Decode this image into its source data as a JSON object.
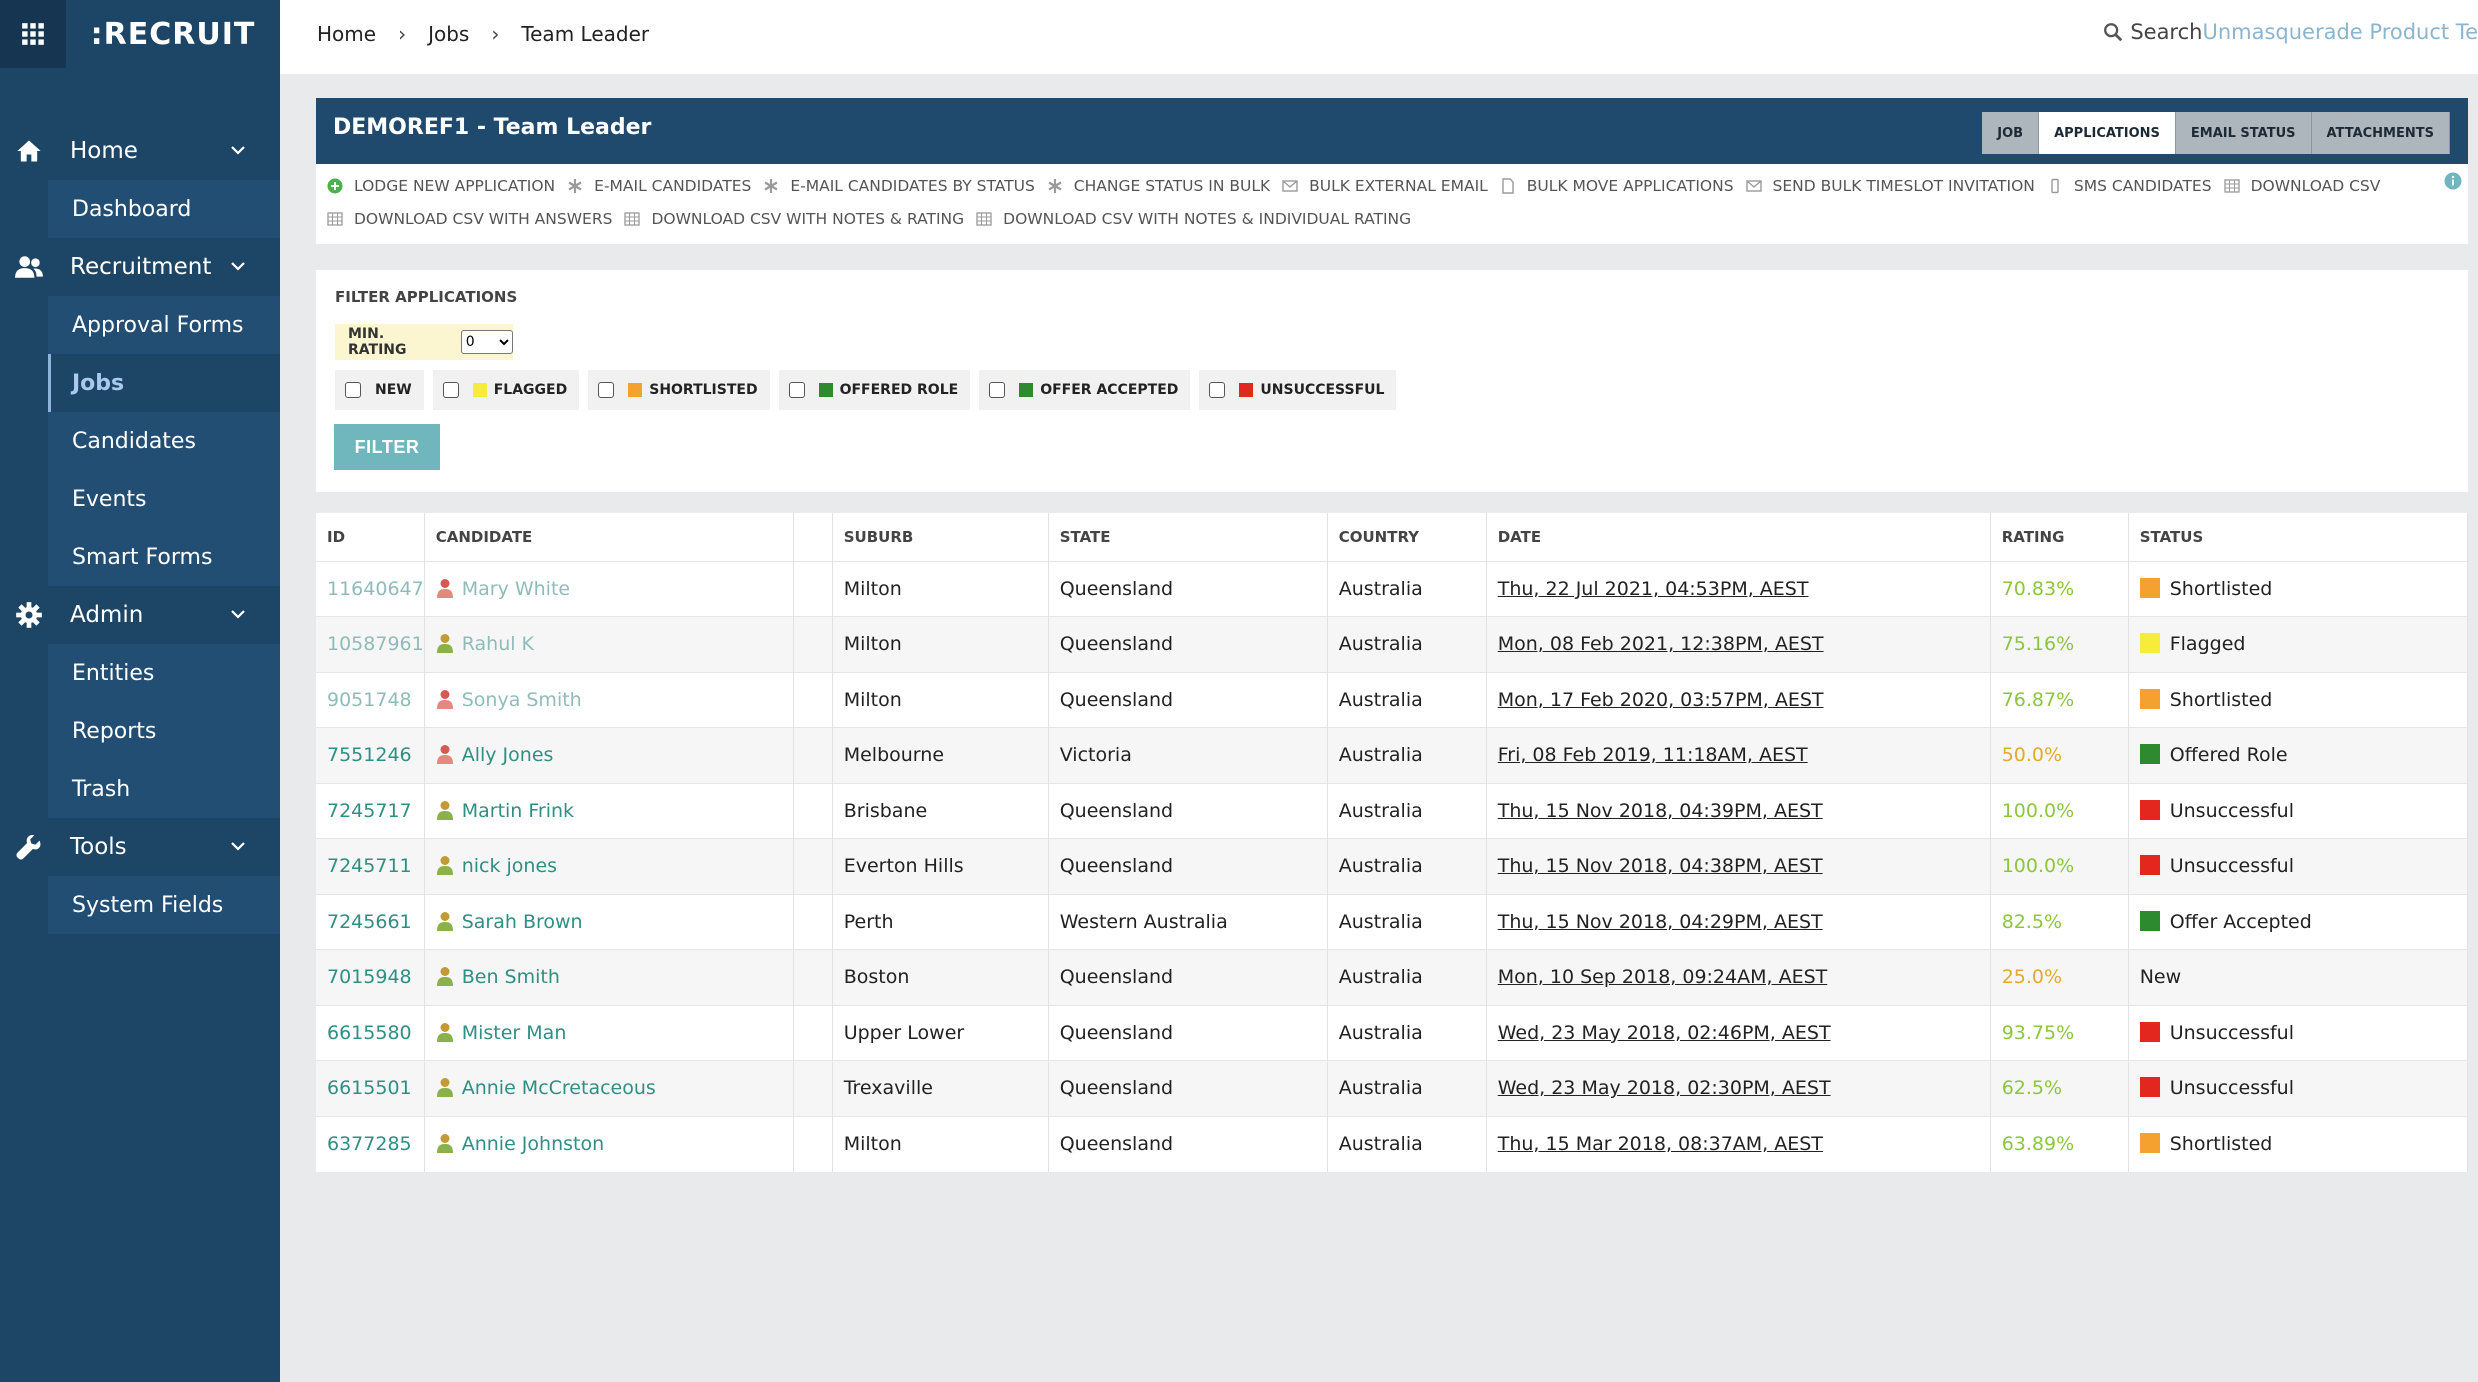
{
  "app": {
    "logo": ":RECRUIT"
  },
  "colors": {
    "sidebar": "#1d4565",
    "header": "#1f4a6e",
    "accent": "#6fb7bd",
    "link": "#2f8f83",
    "rating_green": "#8cc63f",
    "rating_amber": "#e6a82e",
    "status": {
      "Shortlisted": "#f5a130",
      "Flagged": "#f7ec3a",
      "Offered Role": "#2e8a2e",
      "Offer Accepted": "#2e8a2e",
      "Unsuccessful": "#e3261e",
      "New": "transparent"
    }
  },
  "sidebar": {
    "home": {
      "label": "Home",
      "icon": "home-icon",
      "items": [
        {
          "label": "Dashboard"
        }
      ]
    },
    "recruitment": {
      "label": "Recruitment",
      "icon": "users-icon",
      "items": [
        {
          "label": "Approval Forms"
        },
        {
          "label": "Jobs"
        },
        {
          "label": "Candidates"
        },
        {
          "label": "Events"
        },
        {
          "label": "Smart Forms"
        }
      ]
    },
    "admin": {
      "label": "Admin",
      "icon": "gear-icon",
      "items": [
        {
          "label": "Entities"
        },
        {
          "label": "Reports"
        },
        {
          "label": "Trash"
        }
      ]
    },
    "tools": {
      "label": "Tools",
      "icon": "wrench-icon",
      "items": [
        {
          "label": "System Fields"
        }
      ]
    }
  },
  "breadcrumb": {
    "home": "Home",
    "jobs": "Jobs",
    "current": "Team Leader"
  },
  "search": {
    "label": "Search",
    "project": "Unmasquerade Product Te"
  },
  "job": {
    "title": "DEMOREF1 - Team Leader"
  },
  "tabs": [
    {
      "label": "JOB"
    },
    {
      "label": "APPLICATIONS"
    },
    {
      "label": "EMAIL STATUS"
    },
    {
      "label": "ATTACHMENTS"
    }
  ],
  "actions": {
    "row1": [
      {
        "label": "LODGE NEW APPLICATION",
        "icon": "plus-circle-icon"
      },
      {
        "label": "E-MAIL CANDIDATES",
        "icon": "asterisk-icon"
      },
      {
        "label": "E-MAIL CANDIDATES BY STATUS",
        "icon": "asterisk-icon"
      },
      {
        "label": "CHANGE STATUS IN BULK",
        "icon": "asterisk-icon"
      },
      {
        "label": "BULK EXTERNAL EMAIL",
        "icon": "envelope-icon"
      },
      {
        "label": "BULK MOVE APPLICATIONS",
        "icon": "file-icon"
      },
      {
        "label": "SEND BULK TIMESLOT INVITATION",
        "icon": "envelope-icon"
      },
      {
        "label": "SMS CANDIDATES",
        "icon": "mobile-icon"
      },
      {
        "label": "DOWNLOAD CSV",
        "icon": "table-icon"
      }
    ],
    "row2": [
      {
        "label": "DOWNLOAD CSV WITH ANSWERS",
        "icon": "table-icon"
      },
      {
        "label": "DOWNLOAD CSV WITH NOTES & RATING",
        "icon": "table-icon"
      },
      {
        "label": "DOWNLOAD CSV WITH NOTES & INDIVIDUAL RATING",
        "icon": "table-icon"
      }
    ]
  },
  "filter": {
    "title": "FILTER APPLICATIONS",
    "min_rating_label": "MIN. RATING",
    "min_rating_value": "0",
    "statuses": [
      {
        "label": "NEW",
        "color": ""
      },
      {
        "label": "FLAGGED",
        "color": "#f7ec3a"
      },
      {
        "label": "SHORTLISTED",
        "color": "#f5a130"
      },
      {
        "label": "OFFERED ROLE",
        "color": "#2e8a2e"
      },
      {
        "label": "OFFER ACCEPTED",
        "color": "#2e8a2e"
      },
      {
        "label": "UNSUCCESSFUL",
        "color": "#e3261e"
      }
    ],
    "button": "FILTER"
  },
  "table": {
    "columns": [
      "ID",
      "CANDIDATE",
      "",
      "SUBURB",
      "STATE",
      "COUNTRY",
      "DATE",
      "RATING",
      "STATUS"
    ],
    "rows": [
      {
        "id": "11640647",
        "name": "Mary White",
        "gender": "female",
        "suburb": "Milton",
        "state": "Queensland",
        "country": "Australia",
        "date": "Thu, 22 Jul 2021, 04:53PM, AEST",
        "rating": "70.83%",
        "rating_level": "green",
        "status": "Shortlisted",
        "faded": true
      },
      {
        "id": "10587961",
        "name": "Rahul K",
        "gender": "male",
        "suburb": "Milton",
        "state": "Queensland",
        "country": "Australia",
        "date": "Mon, 08 Feb 2021, 12:38PM, AEST",
        "rating": "75.16%",
        "rating_level": "green",
        "status": "Flagged",
        "faded": true
      },
      {
        "id": "9051748",
        "name": "Sonya Smith",
        "gender": "female",
        "suburb": "Milton",
        "state": "Queensland",
        "country": "Australia",
        "date": "Mon, 17 Feb 2020, 03:57PM, AEST",
        "rating": "76.87%",
        "rating_level": "green",
        "status": "Shortlisted",
        "faded": true
      },
      {
        "id": "7551246",
        "name": "Ally Jones",
        "gender": "female",
        "suburb": "Melbourne",
        "state": "Victoria",
        "country": "Australia",
        "date": "Fri, 08 Feb 2019, 11:18AM, AEST",
        "rating": "50.0%",
        "rating_level": "amber",
        "status": "Offered Role",
        "faded": false
      },
      {
        "id": "7245717",
        "name": "Martin Frink",
        "gender": "male",
        "suburb": "Brisbane",
        "state": "Queensland",
        "country": "Australia",
        "date": "Thu, 15 Nov 2018, 04:39PM, AEST",
        "rating": "100.0%",
        "rating_level": "green",
        "status": "Unsuccessful",
        "faded": false
      },
      {
        "id": "7245711",
        "name": "nick jones",
        "gender": "male",
        "suburb": "Everton Hills",
        "state": "Queensland",
        "country": "Australia",
        "date": "Thu, 15 Nov 2018, 04:38PM, AEST",
        "rating": "100.0%",
        "rating_level": "green",
        "status": "Unsuccessful",
        "faded": false
      },
      {
        "id": "7245661",
        "name": "Sarah Brown",
        "gender": "male",
        "suburb": "Perth",
        "state": "Western Australia",
        "country": "Australia",
        "date": "Thu, 15 Nov 2018, 04:29PM, AEST",
        "rating": "82.5%",
        "rating_level": "green",
        "status": "Offer Accepted",
        "faded": false
      },
      {
        "id": "7015948",
        "name": "Ben Smith",
        "gender": "male",
        "suburb": "Boston",
        "state": "Queensland",
        "country": "Australia",
        "date": "Mon, 10 Sep 2018, 09:24AM, AEST",
        "rating": "25.0%",
        "rating_level": "amber",
        "status": "New",
        "faded": false
      },
      {
        "id": "6615580",
        "name": "Mister Man",
        "gender": "male",
        "suburb": "Upper Lower",
        "state": "Queensland",
        "country": "Australia",
        "date": "Wed, 23 May 2018, 02:46PM, AEST",
        "rating": "93.75%",
        "rating_level": "green",
        "status": "Unsuccessful",
        "faded": false
      },
      {
        "id": "6615501",
        "name": "Annie McCretaceous",
        "gender": "male",
        "suburb": "Trexaville",
        "state": "Queensland",
        "country": "Australia",
        "date": "Wed, 23 May 2018, 02:30PM, AEST",
        "rating": "62.5%",
        "rating_level": "green",
        "status": "Unsuccessful",
        "faded": false
      },
      {
        "id": "6377285",
        "name": "Annie Johnston",
        "gender": "male",
        "suburb": "Milton",
        "state": "Queensland",
        "country": "Australia",
        "date": "Thu, 15 Mar 2018, 08:37AM, AEST",
        "rating": "63.89%",
        "rating_level": "green",
        "status": "Shortlisted",
        "faded": false
      }
    ]
  }
}
